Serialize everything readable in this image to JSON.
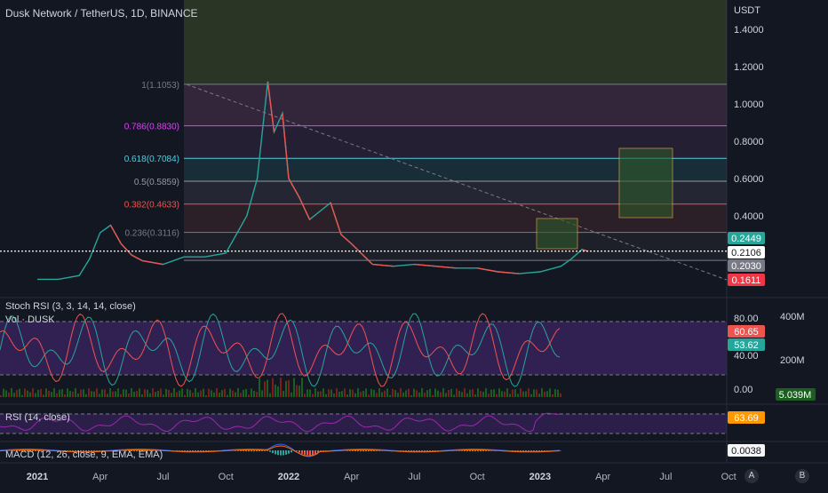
{
  "header": {
    "symbol": "Dusk Network / TetherUS, 1D, BINANCE"
  },
  "price_axis": {
    "unit": "USDT",
    "ticks": [
      "1.4000",
      "1.2000",
      "1.0000",
      "0.8000",
      "0.6000",
      "0.4000"
    ]
  },
  "time_axis": {
    "labels": [
      "2021",
      "Apr",
      "Jul",
      "Oct",
      "2022",
      "Apr",
      "Jul",
      "Oct",
      "2023",
      "Apr",
      "Jul",
      "Oct"
    ]
  },
  "price_badges": [
    {
      "text": "0.2449",
      "bg": "#26a69a",
      "fg": "#ffffff"
    },
    {
      "text": "0.2106",
      "bg": "#ffffff",
      "fg": "#131722"
    },
    {
      "text": "0.2030",
      "bg": "#787b86",
      "fg": "#ffffff"
    },
    {
      "text": "0.1611",
      "bg": "#f23645",
      "fg": "#ffffff"
    }
  ],
  "fib_levels": [
    {
      "label": "1(1.1053)",
      "value": 1.1053,
      "color": "#787b86"
    },
    {
      "label": "0.786(0.8830)",
      "value": 0.883,
      "color": "#e040fb"
    },
    {
      "label": "0.618(0.7084)",
      "value": 0.7084,
      "color": "#4dd0e1"
    },
    {
      "label": "0.5(0.5859)",
      "value": 0.5859,
      "color": "#9598a1"
    },
    {
      "label": "0.382(0.4633)",
      "value": 0.4633,
      "color": "#ef5350"
    },
    {
      "label": "0.236(0.3116)",
      "value": 0.3116,
      "color": "#787b86"
    }
  ],
  "indicators": {
    "stoch": {
      "label": "Stoch RSI (3, 3, 14, 14, close)",
      "ticks": [
        "80.00",
        "40.00",
        "0.00"
      ],
      "k": "60.65",
      "d": "53.62",
      "k_color": "#ef5350",
      "d_color": "#26a69a"
    },
    "volume": {
      "label": "Vol · DUSK",
      "ticks": [
        "400M",
        "200M"
      ],
      "last": "5.039M",
      "last_bg": "#1b5e20"
    },
    "rsi": {
      "label": "RSI (14, close)",
      "last": "63.69",
      "color": "#ff9800"
    },
    "macd": {
      "label": "MACD (12, 26, close, 9, EMA, EMA)",
      "last": "0.0038",
      "color": "#f5f5f5"
    }
  },
  "scale_buttons": [
    "A",
    "B"
  ],
  "chart_data": {
    "type": "line",
    "title": "Dusk Network / TetherUS, 1D, BINANCE",
    "x_unit": "month index from Jan 2021",
    "x": [
      0,
      1,
      2,
      2.5,
      3,
      3.5,
      4,
      4.5,
      5,
      6,
      7,
      8,
      9,
      10,
      10.5,
      11,
      11.3,
      11.7,
      12,
      12.5,
      13,
      14,
      14.5,
      15,
      16,
      17,
      18,
      19,
      20,
      21,
      22,
      23,
      24,
      25,
      25.5,
      26,
      26.3
    ],
    "values": [
      0.06,
      0.06,
      0.08,
      0.17,
      0.31,
      0.35,
      0.25,
      0.19,
      0.16,
      0.14,
      0.18,
      0.18,
      0.2,
      0.4,
      0.6,
      1.12,
      0.85,
      0.95,
      0.6,
      0.5,
      0.38,
      0.47,
      0.3,
      0.25,
      0.14,
      0.13,
      0.14,
      0.13,
      0.12,
      0.12,
      0.1,
      0.09,
      0.1,
      0.13,
      0.17,
      0.22,
      0.21
    ],
    "ylim": [
      0.0,
      1.5
    ],
    "last_price": 0.2106
  }
}
